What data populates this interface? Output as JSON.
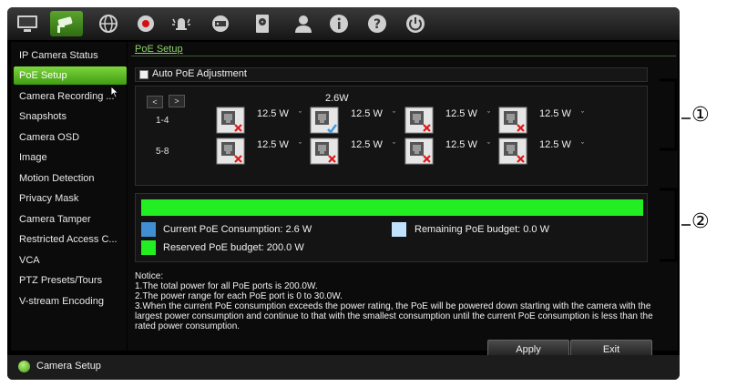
{
  "sidebar": {
    "items": [
      {
        "label": "IP Camera Status"
      },
      {
        "label": "PoE Setup"
      },
      {
        "label": "Camera Recording ..."
      },
      {
        "label": "Snapshots"
      },
      {
        "label": "Camera OSD"
      },
      {
        "label": "Image"
      },
      {
        "label": "Motion Detection"
      },
      {
        "label": "Privacy Mask"
      },
      {
        "label": "Camera Tamper"
      },
      {
        "label": "Restricted Access C..."
      },
      {
        "label": "VCA"
      },
      {
        "label": "PTZ Presets/Tours"
      },
      {
        "label": "V-stream Encoding"
      }
    ],
    "selected": "PoE Setup"
  },
  "content": {
    "breadcrumb": "PoE Setup",
    "auto_poe_label": "Auto PoE Adjustment",
    "auto_poe_checked": false,
    "nav_prev": "<",
    "nav_next": ">",
    "rows": [
      {
        "label": "1-4",
        "ports": [
          {
            "watt": "12.5 W",
            "status": "error",
            "top_label": ""
          },
          {
            "watt": "12.5 W",
            "status": "ok",
            "top_label": "2.6W"
          },
          {
            "watt": "12.5 W",
            "status": "error",
            "top_label": ""
          },
          {
            "watt": "12.5 W",
            "status": "error",
            "top_label": ""
          }
        ]
      },
      {
        "label": "5-8",
        "ports": [
          {
            "watt": "12.5 W",
            "status": "error",
            "top_label": ""
          },
          {
            "watt": "12.5 W",
            "status": "error",
            "top_label": ""
          },
          {
            "watt": "12.5 W",
            "status": "error",
            "top_label": ""
          },
          {
            "watt": "12.5 W",
            "status": "error",
            "top_label": ""
          }
        ]
      }
    ],
    "legend": {
      "current": "Current PoE Consumption: 2.6 W",
      "remaining": "Remaining PoE budget: 0.0 W",
      "reserved": "Reserved PoE budget: 200.0 W",
      "colors": {
        "current": "#3f8fd2",
        "remaining": "#bfe3ff",
        "reserved": "#22ee22",
        "bar": "#22ee22"
      }
    },
    "notice": {
      "title": "Notice:",
      "lines": [
        "1.The total power for all PoE ports is 200.0W.",
        "2.The power range for each PoE port is 0 to 30.0W.",
        "3.When the current PoE consumption exceeds the power rating, the PoE will be powered down starting with the camera with the largest power consumption and continue to that with the smallest consumption until the current PoE consumption is less than the rated power consumption."
      ]
    },
    "apply_label": "Apply",
    "exit_label": "Exit"
  },
  "status_bar": {
    "label": "Camera Setup"
  },
  "callouts": [
    "①",
    "②"
  ],
  "toolbar": {
    "icons": [
      "monitor-icon",
      "camera-icon",
      "network-icon",
      "record-icon",
      "alarm-icon",
      "device-icon",
      "hdd-icon",
      "user-icon",
      "info-icon",
      "help-icon",
      "power-icon"
    ],
    "active": "camera-icon"
  }
}
